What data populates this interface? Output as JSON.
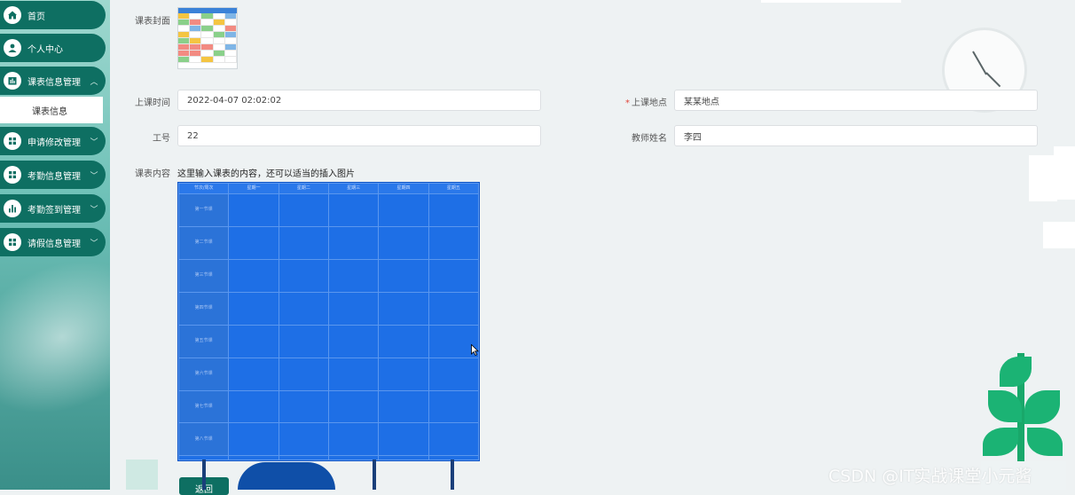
{
  "sidebar": {
    "items": [
      {
        "label": "首页",
        "icon": "home-icon"
      },
      {
        "label": "个人中心",
        "icon": "user-icon"
      },
      {
        "label": "课表信息管理",
        "icon": "chart-icon",
        "expanded": true,
        "children": [
          {
            "label": "课表信息",
            "active": true
          }
        ]
      },
      {
        "label": "申请修改管理",
        "icon": "grid-icon"
      },
      {
        "label": "考勤信息管理",
        "icon": "grid-icon"
      },
      {
        "label": "考勤签到管理",
        "icon": "chart-icon"
      },
      {
        "label": "请假信息管理",
        "icon": "grid-icon"
      }
    ]
  },
  "form": {
    "cover_label": "课表封面",
    "time_label": "上课时间",
    "time_value": "2022-04-07 02:02:02",
    "place_label": "上课地点",
    "place_value": "某某地点",
    "id_label": "工号",
    "id_value": "22",
    "teacher_label": "教师姓名",
    "teacher_value": "李四",
    "content_label": "课表内容",
    "content_hint": "这里输入课表的内容，还可以适当的插入图片"
  },
  "schedule": {
    "headers": [
      "节次/周次",
      "星期一",
      "星期二",
      "星期三",
      "星期四",
      "星期五"
    ],
    "slots": [
      "第一节课",
      "第二节课",
      "第三节课",
      "第四节课",
      "第五节课",
      "第六节课",
      "第七节课",
      "第八节课"
    ]
  },
  "buttons": {
    "return_label": "返回"
  },
  "watermark": "CSDN @IT实战课堂小元酱",
  "colors": {
    "sidebar_item": "#0e6f62",
    "selection": "#1e6fe6",
    "required": "#e0473c"
  }
}
